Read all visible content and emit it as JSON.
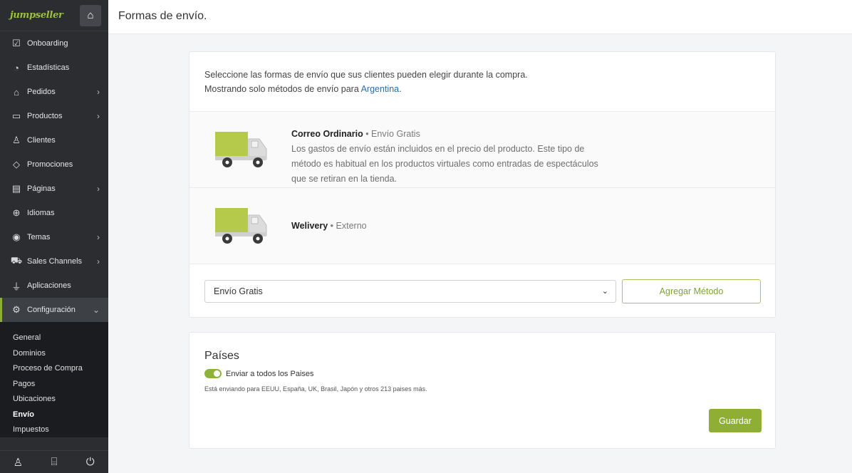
{
  "sidebar": {
    "logo": "jumpseller",
    "items": [
      {
        "label": "Onboarding",
        "icon": "checkbox-icon",
        "has_children": false
      },
      {
        "label": "Estadísticas",
        "icon": "gauge-icon",
        "has_children": false
      },
      {
        "label": "Pedidos",
        "icon": "basket-icon",
        "has_children": true
      },
      {
        "label": "Productos",
        "icon": "box-icon",
        "has_children": true
      },
      {
        "label": "Clientes",
        "icon": "users-icon",
        "has_children": false
      },
      {
        "label": "Promociones",
        "icon": "tag-icon",
        "has_children": false
      },
      {
        "label": "Páginas",
        "icon": "page-icon",
        "has_children": true
      },
      {
        "label": "Idiomas",
        "icon": "globe-icon",
        "has_children": false
      },
      {
        "label": "Temas",
        "icon": "eye-icon",
        "has_children": true
      },
      {
        "label": "Sales Channels",
        "icon": "cart-icon",
        "has_children": true
      },
      {
        "label": "Aplicaciones",
        "icon": "plug-icon",
        "has_children": false
      },
      {
        "label": "Configuración",
        "icon": "settings-icon",
        "has_children": true,
        "expanded": true
      }
    ],
    "submenu": [
      "General",
      "Dominios",
      "Proceso de Compra",
      "Pagos",
      "Ubicaciones",
      "Envío",
      "Impuestos"
    ],
    "current_submenu": "Envío",
    "footer_icons": [
      "user-icon",
      "store-icon",
      "power-icon"
    ]
  },
  "header": {
    "title": "Formas de envío."
  },
  "methods_card": {
    "intro_line1": "Seleccione las formas de envío que sus clientes pueden elegir durante la compra.",
    "intro_line2_prefix": "Mostrando solo métodos de envío para ",
    "intro_country": "Argentina",
    "intro_suffix": ".",
    "methods": [
      {
        "name": "Correo Ordinario",
        "separator": " • ",
        "type": "Envío Gratis",
        "description": "Los gastos de envío están incluidos en el precio del producto. Este tipo de método es habitual en los productos virtuales como entradas de espectáculos que se retiran en la tienda."
      },
      {
        "name": "Welivery",
        "separator": " • ",
        "type": "Externo",
        "description": ""
      }
    ],
    "select_value": "Envío Gratis",
    "add_button": "Agregar Método"
  },
  "countries_card": {
    "title": "Países",
    "toggle_label": "Enviar a todos los Paises",
    "toggle_on": true,
    "note": "Está enviando para EEUU, España, UK, Brasil, Japón y otros 213 paises más.",
    "save_button": "Guardar"
  },
  "colors": {
    "accent": "#8fae34",
    "sidebar": "#2b2d31",
    "truck_green": "#b5c94a"
  }
}
